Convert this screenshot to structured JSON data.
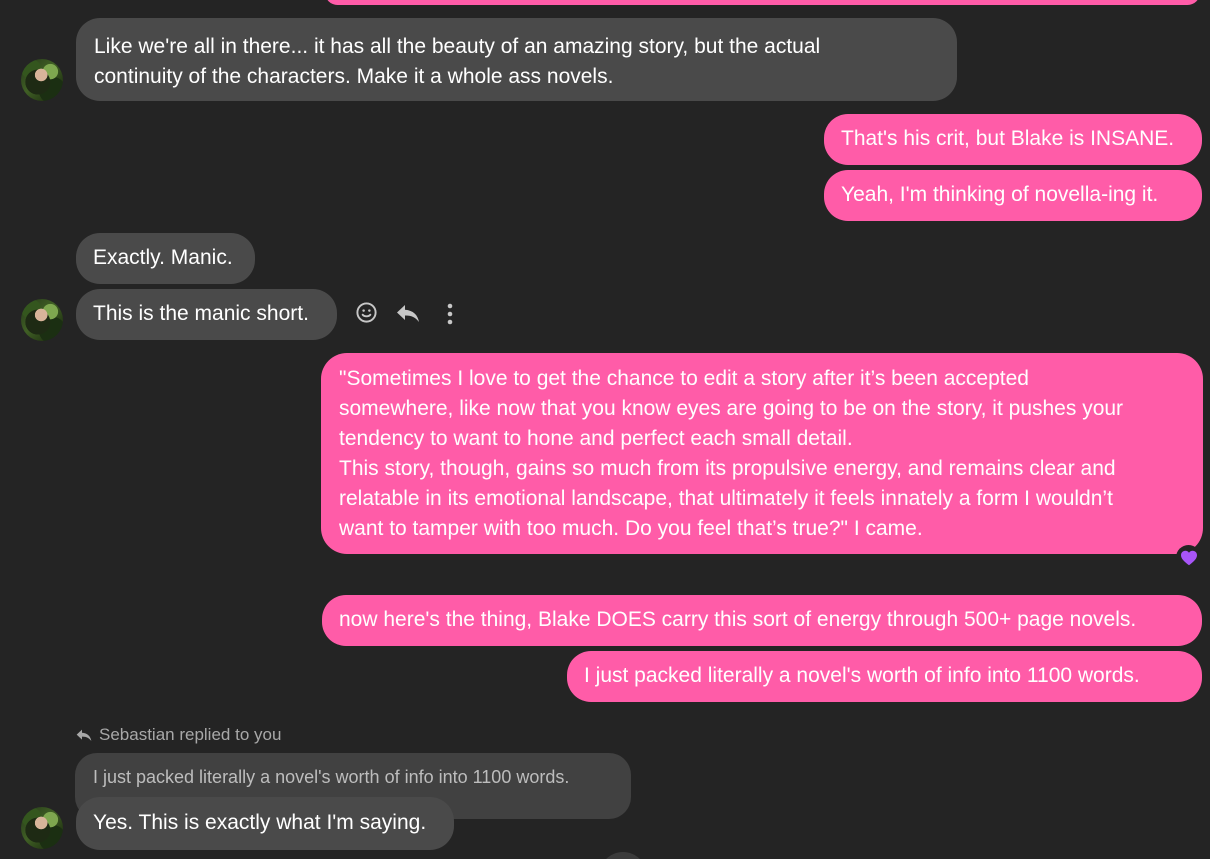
{
  "colors": {
    "background": "#242424",
    "incoming_bubble": "#4a4a4a",
    "outgoing_bubble": "#ff5ca8",
    "quoted_bubble": "#414141",
    "reaction_heart": "#a855f7"
  },
  "messages": [
    {
      "id": "m1",
      "direction": "incoming",
      "text": "Like we're all in there... it has all the beauty of an amazing story, but the actual\ncontinuity of the characters. Make it a whole ass novels."
    },
    {
      "id": "m2",
      "direction": "outgoing",
      "text": "That's his crit, but Blake is INSANE."
    },
    {
      "id": "m3",
      "direction": "outgoing",
      "text": "Yeah, I'm thinking of novella-ing it."
    },
    {
      "id": "m4",
      "direction": "incoming",
      "text": "Exactly. Manic."
    },
    {
      "id": "m5",
      "direction": "incoming",
      "text": "This is the manic short."
    },
    {
      "id": "m6",
      "direction": "outgoing",
      "text": "\"Sometimes I love to get the chance to edit a story after it’s been accepted\nsomewhere, like now that you know eyes are going to be on the story, it pushes your\ntendency to want to hone and perfect each small detail.\nThis story, though, gains so much from its propulsive energy, and remains clear and\nrelatable in its emotional landscape, that ultimately it feels innately a form I wouldn’t\nwant to tamper with too much. Do you feel that’s true?\" I came.",
      "reaction": "purple-heart"
    },
    {
      "id": "m7",
      "direction": "outgoing",
      "text": "now here's the thing, Blake DOES carry this sort of energy through 500+ page novels."
    },
    {
      "id": "m8",
      "direction": "outgoing",
      "text": "I just packed literally a novel's worth of info into 1100 words."
    }
  ],
  "reply_block": {
    "status": "Sebastian replied to you",
    "quoted_text": "I just packed literally a novel's worth of info into 1100 words.",
    "reply_text": "Yes. This is exactly what I'm saying."
  },
  "message_actions": [
    "emoji-icon",
    "reply-icon",
    "more-options-icon"
  ]
}
